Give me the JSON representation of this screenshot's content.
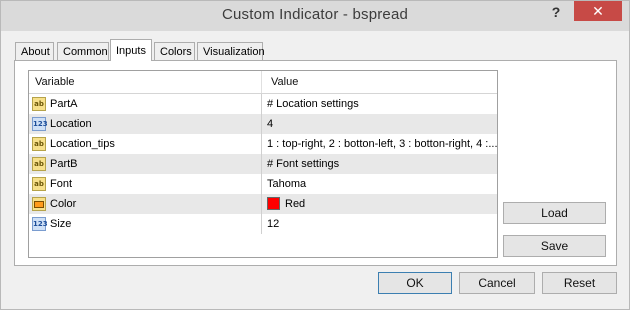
{
  "window": {
    "title": "Custom Indicator - bspread",
    "help_glyph": "?",
    "close_glyph": "✕"
  },
  "tabs": [
    {
      "label": "About"
    },
    {
      "label": "Common"
    },
    {
      "label": "Inputs",
      "active": true
    },
    {
      "label": "Colors"
    },
    {
      "label": "Visualization"
    }
  ],
  "grid": {
    "columns": {
      "variable": "Variable",
      "value": "Value"
    },
    "rows": [
      {
        "type_icon": "string-type-icon",
        "type_text": "ab",
        "variable": "PartA",
        "value": "# Location settings"
      },
      {
        "type_icon": "integer-type-icon",
        "type_text": "123",
        "variable": "Location",
        "value": "4"
      },
      {
        "type_icon": "string-type-icon",
        "type_text": "ab",
        "variable": "Location_tips",
        "value": " 1 : top-right, 2 : botton-left, 3 : botton-right, 4 :..."
      },
      {
        "type_icon": "string-type-icon",
        "type_text": "ab",
        "variable": "PartB",
        "value": "# Font settings"
      },
      {
        "type_icon": "string-type-icon",
        "type_text": "ab",
        "variable": "Font",
        "value": "Tahoma"
      },
      {
        "type_icon": "color-type-icon",
        "type_text": "",
        "variable": "Color",
        "value": "Red",
        "swatch_color": "#ff0000"
      },
      {
        "type_icon": "integer-type-icon",
        "type_text": "123",
        "variable": "Size",
        "value": "12"
      }
    ]
  },
  "side_buttons": {
    "load": "Load",
    "save": "Save"
  },
  "footer_buttons": {
    "ok": "OK",
    "cancel": "Cancel",
    "reset": "Reset"
  }
}
